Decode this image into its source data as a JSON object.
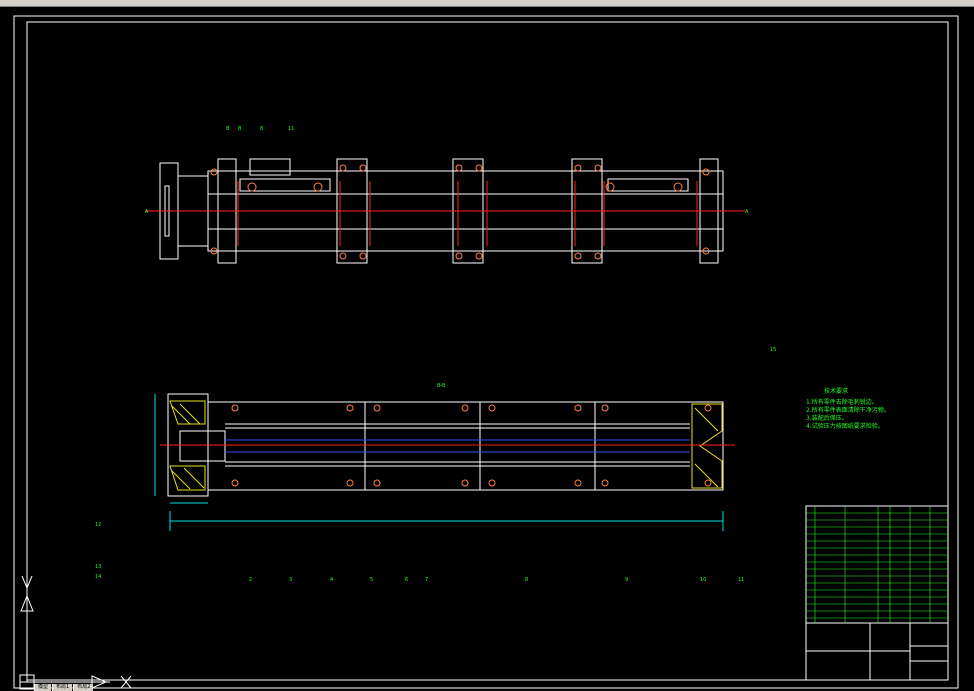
{
  "technical_requirements": {
    "title": "技术要求",
    "items": [
      "1.所有零件去除毛刺锐边。",
      "2.所有零件表面清除干净污物。",
      "3.装配后保压。",
      "4.试验压力按图纸要求检验。"
    ]
  },
  "callouts": [
    "2",
    "3",
    "4",
    "5",
    "6",
    "7",
    "8",
    "9",
    "10",
    "11",
    "12",
    "13",
    "14",
    "15",
    "16"
  ],
  "dimension_labels": [
    "B-B",
    "A-A"
  ],
  "layout_tabs": [
    "模型",
    "布局1",
    "布局2"
  ],
  "colors": {
    "background": "#000000",
    "border": "#ffffff",
    "outline": "#ffffff",
    "center_line": "#ff2020",
    "hatch": "#e8e020",
    "annotation": "#22ff22",
    "dimension": "#00e0e0",
    "bolt": "#ff8040"
  }
}
